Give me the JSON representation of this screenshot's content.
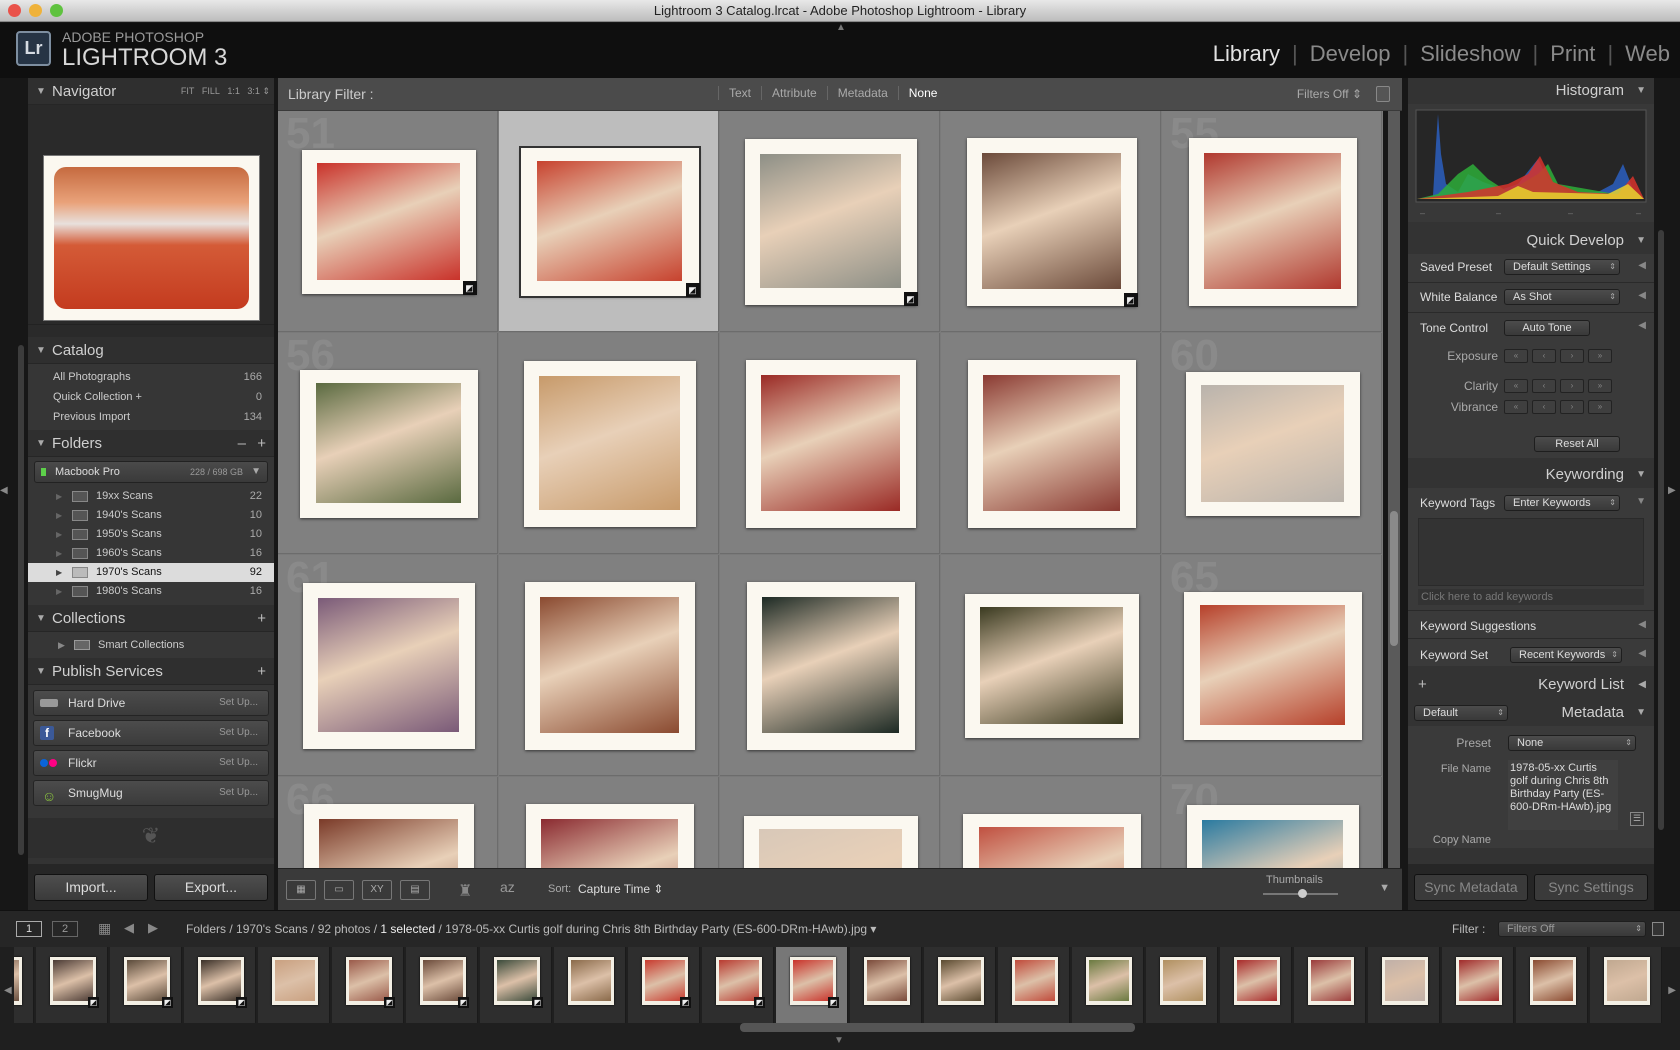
{
  "window_title": "Lightroom 3 Catalog.lrcat - Adobe Photoshop Lightroom - Library",
  "brand": {
    "logo": "Lr",
    "line1": "ADOBE PHOTOSHOP",
    "line2": "LIGHTROOM 3"
  },
  "modules": [
    {
      "label": "Library",
      "active": true
    },
    {
      "label": "Develop"
    },
    {
      "label": "Slideshow"
    },
    {
      "label": "Print"
    },
    {
      "label": "Web"
    }
  ],
  "navigator": {
    "title": "Navigator",
    "zoom": [
      "FIT",
      "FILL",
      "1:1",
      "3:1"
    ]
  },
  "catalog": {
    "title": "Catalog",
    "items": [
      {
        "label": "All Photographs",
        "count": "166"
      },
      {
        "label": "Quick Collection +",
        "count": "0"
      },
      {
        "label": "Previous Import",
        "count": "134"
      }
    ]
  },
  "folders": {
    "title": "Folders",
    "minus": "–",
    "plus": "+",
    "volume": {
      "name": "Macbook Pro",
      "space": "228 / 698 GB"
    },
    "items": [
      {
        "label": "19xx Scans",
        "count": "22"
      },
      {
        "label": "1940's Scans",
        "count": "10"
      },
      {
        "label": "1950's Scans",
        "count": "10"
      },
      {
        "label": "1960's Scans",
        "count": "16"
      },
      {
        "label": "1970's Scans",
        "count": "92",
        "selected": true
      },
      {
        "label": "1980's Scans",
        "count": "16"
      }
    ]
  },
  "collections": {
    "title": "Collections",
    "plus": "+",
    "items": [
      {
        "label": "Smart Collections"
      }
    ]
  },
  "publish": {
    "title": "Publish Services",
    "plus": "+",
    "items": [
      {
        "label": "Hard Drive",
        "action": "Set Up..."
      },
      {
        "label": "Facebook",
        "action": "Set Up..."
      },
      {
        "label": "Flickr",
        "action": "Set Up..."
      },
      {
        "label": "SmugMug",
        "action": "Set Up..."
      }
    ]
  },
  "import_btn": "Import...",
  "export_btn": "Export...",
  "filter_bar": {
    "label": "Library Filter :",
    "tabs": [
      "Text",
      "Attribute",
      "Metadata",
      "None"
    ],
    "active_tab": "None",
    "preset": "Filters Off"
  },
  "grid": {
    "row_numbers": [
      "51",
      "56",
      "61",
      "66"
    ],
    "row_ends": [
      "55",
      "60",
      "65",
      "70"
    ],
    "selected_index": 1,
    "colors": [
      "#c9322a",
      "#c7422e",
      "#8d8f86",
      "#6b4a3a",
      "#b0382e",
      "#5a6a40",
      "#c79a6a",
      "#9a2a25",
      "#8a3a32",
      "#b9b3ac",
      "#7a5a78",
      "#8a4a30",
      "#1d2a24",
      "#3a3a20",
      "#b6402a",
      "#7a3a28",
      "#8a2a30",
      "#d8c8b8",
      "#c05040",
      "#2a7aa0"
    ]
  },
  "toolbar": {
    "sort_label": "Sort:",
    "sort_value": "Capture Time",
    "thumbnails_label": "Thumbnails"
  },
  "histogram": {
    "title": "Histogram"
  },
  "quick_develop": {
    "title": "Quick Develop",
    "saved_preset_label": "Saved Preset",
    "saved_preset": "Default Settings",
    "wb_label": "White Balance",
    "wb_value": "As Shot",
    "tone_label": "Tone Control",
    "tone_btn": "Auto Tone",
    "exposure": "Exposure",
    "clarity": "Clarity",
    "vibrance": "Vibrance",
    "reset": "Reset All"
  },
  "keywording": {
    "title": "Keywording",
    "tags_label": "Keyword Tags",
    "tags_value": "Enter Keywords",
    "add_placeholder": "Click here to add keywords",
    "suggestions": "Keyword Suggestions",
    "set_label": "Keyword Set",
    "set_value": "Recent Keywords"
  },
  "keyword_list": {
    "title": "Keyword List",
    "plus": "+"
  },
  "metadata": {
    "title": "Metadata",
    "preset_select": "Default",
    "preset_label": "Preset",
    "preset_value": "None",
    "filename_label": "File Name",
    "filename_value": "1978-05-xx Curtis golf during Chris 8th Birthday Party (ES-600-DRm-HAwb).jpg",
    "copyname_label": "Copy Name"
  },
  "sync": {
    "metadata": "Sync Metadata",
    "settings": "Sync Settings"
  },
  "filmbar": {
    "pages": [
      "1",
      "2"
    ],
    "path_prefix": "Folders / 1970's Scans / 92 photos /",
    "selected": "1 selected",
    "path_suffix": "/ 1978-05-xx Curtis golf during Chris 8th Birthday Party (ES-600-DRm-HAwb).jpg",
    "filter_label": "Filter :",
    "filter_value": "Filters Off"
  },
  "filmstrip": {
    "selected_index": 11,
    "colors": [
      "#6a5040",
      "#4a3a34",
      "#5a4a3a",
      "#3a3028",
      "#c9a080",
      "#9a5a4a",
      "#6a4a3a",
      "#3a4a3a",
      "#8a6a4a",
      "#c83a2e",
      "#b83a30",
      "#c9322a",
      "#7a4a3a",
      "#5a4a30",
      "#c04a3a",
      "#6a7a40",
      "#b09060",
      "#a82a2a",
      "#9a3a3a",
      "#c0b0a8",
      "#a02a2a",
      "#8a4a30",
      "#c0a890"
    ]
  }
}
